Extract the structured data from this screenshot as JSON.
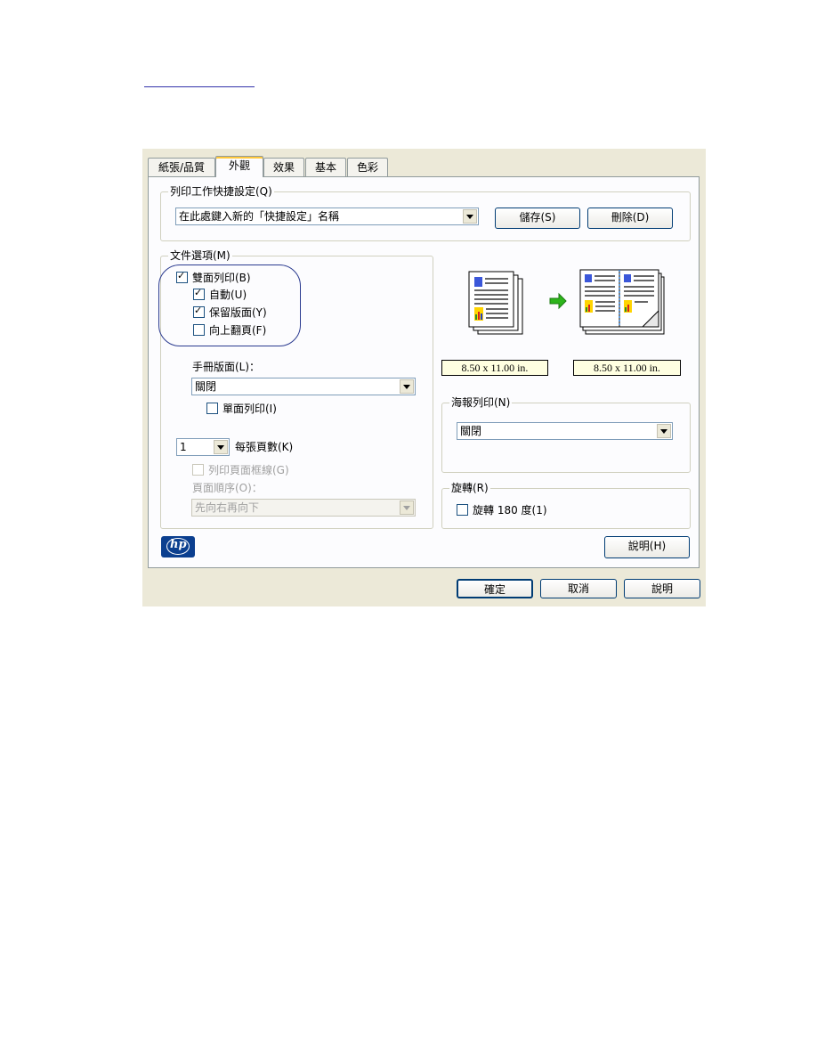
{
  "tabs": [
    "紙張/品質",
    "外觀",
    "效果",
    "基本",
    "色彩"
  ],
  "quick_sets": {
    "legend": "列印工作快捷設定(Q)",
    "value": "在此處鍵入新的「快捷設定」名稱",
    "save": "儲存(S)",
    "delete": "刪除(D)"
  },
  "doc_options": {
    "legend": "文件選項(M)",
    "duplex": "雙面列印(B)",
    "auto": "自動(U)",
    "preserve_layout": "保留版面(Y)",
    "flip_up": "向上翻頁(F)",
    "booklet_label": "手冊版面(L)：",
    "booklet_value": "關閉",
    "single_sided": "單面列印(I)",
    "pages_per_sheet_value": "1",
    "pages_per_sheet_label": "每張頁數(K)",
    "print_borders": "列印頁面框線(G)",
    "page_order_label": "頁面順序(O)：",
    "page_order_value": "先向右再向下"
  },
  "preview": {
    "size_left": "8.50 x 11.00 in.",
    "size_right": "8.50 x 11.00 in."
  },
  "poster": {
    "legend": "海報列印(N)",
    "value": "關閉"
  },
  "rotate": {
    "legend": "旋轉(R)",
    "rotate180": "旋轉 180 度(1)"
  },
  "help_button": "說明(H)",
  "footer": {
    "ok": "確定",
    "cancel": "取消",
    "help": "說明"
  },
  "colors": {
    "dialog_bg": "#ece9d8",
    "panel_bg": "#fcfcfe",
    "size_label_bg": "#ffffe1",
    "arrow_green": "#2db51b"
  }
}
